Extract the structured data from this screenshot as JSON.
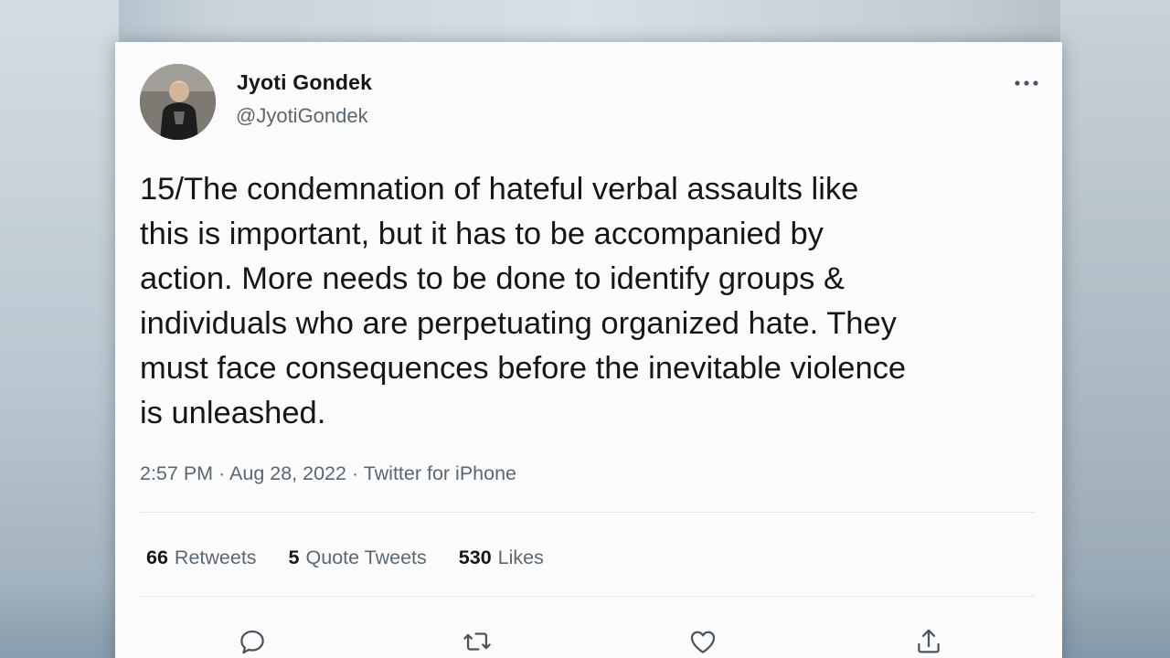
{
  "tweet": {
    "author": {
      "display_name": "Jyoti Gondek",
      "handle": "@JyotiGondek",
      "avatar_icon": "profile-photo"
    },
    "more_icon": "more-horizontal-icon",
    "text": "15/The condemnation of hateful verbal assaults like\nthis is important, but it has to be accompanied by\naction. More needs to be done to identify groups &\nindividuals who are perpetuating organized hate. They\nmust face consequences before the inevitable violence\nis unleashed.",
    "meta": {
      "time": "2:57 PM",
      "date": "Aug 28, 2022",
      "source": "Twitter for iPhone",
      "separator": "·"
    },
    "stats": {
      "retweets": {
        "count": "66",
        "label": "Retweets"
      },
      "quote_tweets": {
        "count": "5",
        "label": "Quote Tweets"
      },
      "likes": {
        "count": "530",
        "label": "Likes"
      }
    },
    "actions": [
      {
        "icon": "reply-icon"
      },
      {
        "icon": "retweet-icon"
      },
      {
        "icon": "like-icon"
      },
      {
        "icon": "share-icon"
      }
    ],
    "colors": {
      "text": "#14171a",
      "secondary": "#5b6770",
      "card": "#fbfbfb"
    }
  }
}
